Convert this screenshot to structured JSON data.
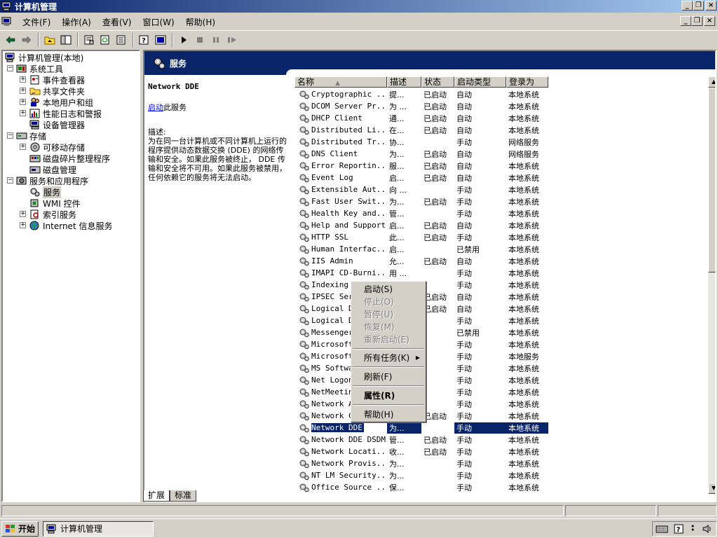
{
  "window": {
    "title": "计算机管理"
  },
  "menu": [
    "文件(F)",
    "操作(A)",
    "查看(V)",
    "窗口(W)",
    "帮助(H)"
  ],
  "tree": [
    {
      "label": "计算机管理(本地)",
      "icon": "computer-icon"
    },
    {
      "label": "系统工具",
      "icon": "tools-icon"
    },
    {
      "label": "事件查看器",
      "icon": "event-viewer-icon"
    },
    {
      "label": "共享文件夹",
      "icon": "shared-folder-icon"
    },
    {
      "label": "本地用户和组",
      "icon": "users-icon"
    },
    {
      "label": "性能日志和警报",
      "icon": "performance-icon"
    },
    {
      "label": "设备管理器",
      "icon": "device-manager-icon"
    },
    {
      "label": "存储",
      "icon": "storage-icon"
    },
    {
      "label": "可移动存储",
      "icon": "removable-storage-icon"
    },
    {
      "label": "磁盘碎片整理程序",
      "icon": "defrag-icon"
    },
    {
      "label": "磁盘管理",
      "icon": "disk-icon"
    },
    {
      "label": "服务和应用程序",
      "icon": "services-apps-icon"
    },
    {
      "label": "服务",
      "icon": "gear-icon"
    },
    {
      "label": "WMI 控件",
      "icon": "wmi-icon"
    },
    {
      "label": "索引服务",
      "icon": "index-icon"
    },
    {
      "label": "Internet 信息服务",
      "icon": "iis-icon"
    }
  ],
  "panel": {
    "title": "服务",
    "service_name": "Network DDE",
    "start_link": "启动",
    "start_suffix": "此服务",
    "desc_label": "描述:",
    "desc_text": "为在同一台计算机或不同计算机上运行的程序提供动态数据交换 (DDE) 的网络传输和安全。如果此服务被终止， DDE 传输和安全将不可用。如果此服务被禁用，任何依赖它的服务将无法启动。"
  },
  "columns": [
    "名称",
    "描述",
    "状态",
    "启动类型",
    "登录为"
  ],
  "services": [
    [
      "Cryptographic ...",
      "提...",
      "已启动",
      "自动",
      "本地系统"
    ],
    [
      "DCOM Server Pr...",
      "为 ...",
      "已启动",
      "自动",
      "本地系统"
    ],
    [
      "DHCP Client",
      "通...",
      "已启动",
      "自动",
      "本地系统"
    ],
    [
      "Distributed Li...",
      "在...",
      "已启动",
      "自动",
      "本地系统"
    ],
    [
      "Distributed Tr...",
      "协...",
      "",
      "手动",
      "网络服务"
    ],
    [
      "DNS Client",
      "为...",
      "已启动",
      "自动",
      "网络服务"
    ],
    [
      "Error Reportin...",
      "服...",
      "已启动",
      "自动",
      "本地系统"
    ],
    [
      "Event Log",
      "启...",
      "已启动",
      "自动",
      "本地系统"
    ],
    [
      "Extensible Aut...",
      "向 ...",
      "",
      "手动",
      "本地系统"
    ],
    [
      "Fast User Swit...",
      "为...",
      "已启动",
      "手动",
      "本地系统"
    ],
    [
      "Health Key and...",
      "管...",
      "",
      "手动",
      "本地系统"
    ],
    [
      "Help and Support",
      "启...",
      "已启动",
      "自动",
      "本地系统"
    ],
    [
      "HTTP SSL",
      "此...",
      "已启动",
      "手动",
      "本地系统"
    ],
    [
      "Human Interfac...",
      "启...",
      "",
      "已禁用",
      "本地系统"
    ],
    [
      "IIS Admin",
      "允...",
      "已启动",
      "自动",
      "本地系统"
    ],
    [
      "IMAPI CD-Burni...",
      "用 ...",
      "",
      "手动",
      "本地系统"
    ],
    [
      "Indexing S",
      "",
      "",
      "手动",
      "本地系统"
    ],
    [
      "IPSEC Serv",
      "",
      "已启动",
      "自动",
      "本地系统"
    ],
    [
      "Logical Di",
      "",
      "已启动",
      "自动",
      "本地系统"
    ],
    [
      "Logical Di",
      "",
      "",
      "手动",
      "本地系统"
    ],
    [
      "Messenger",
      "",
      "",
      "已禁用",
      "本地系统"
    ],
    [
      "Microsoft",
      "",
      "",
      "手动",
      "本地系统"
    ],
    [
      "Microsoft",
      "",
      "",
      "手动",
      "本地服务"
    ],
    [
      "MS Softwar",
      "",
      "",
      "手动",
      "本地系统"
    ],
    [
      "Net Logon",
      "",
      "",
      "手动",
      "本地系统"
    ],
    [
      "NetMeeting",
      "",
      "",
      "手动",
      "本地系统"
    ],
    [
      "Network Ac",
      "",
      "",
      "手动",
      "本地系统"
    ],
    [
      "Network Co",
      "",
      "已启动",
      "手动",
      "本地系统"
    ],
    [
      "Network DDE",
      "为...",
      "",
      "手动",
      "本地系统"
    ],
    [
      "Network DDE DSDM",
      "管...",
      "已启动",
      "手动",
      "本地系统"
    ],
    [
      "Network Locati...",
      "收...",
      "已启动",
      "手动",
      "本地系统"
    ],
    [
      "Network Provis...",
      "为...",
      "",
      "手动",
      "本地系统"
    ],
    [
      "NT LM Security...",
      "为...",
      "",
      "手动",
      "本地系统"
    ],
    [
      "Office Source ...",
      "保...",
      "",
      "手动",
      "本地系统"
    ]
  ],
  "selected_row": 28,
  "context_menu": {
    "start": "启动(S)",
    "stop": "停止(O)",
    "pause": "暂停(U)",
    "resume": "恢复(M)",
    "restart": "重新启动(E)",
    "all_tasks": "所有任务(K)",
    "refresh": "刷新(F)",
    "properties": "属性(R)",
    "help": "帮助(H)"
  },
  "tabs": [
    "扩展",
    "标准"
  ],
  "taskbar": {
    "start": "开始",
    "task": "计算机管理"
  },
  "colors": {
    "title_dark": "#0a246a",
    "title_light": "#a6caf0",
    "face": "#d4d0c8",
    "select": "#0a246a"
  }
}
